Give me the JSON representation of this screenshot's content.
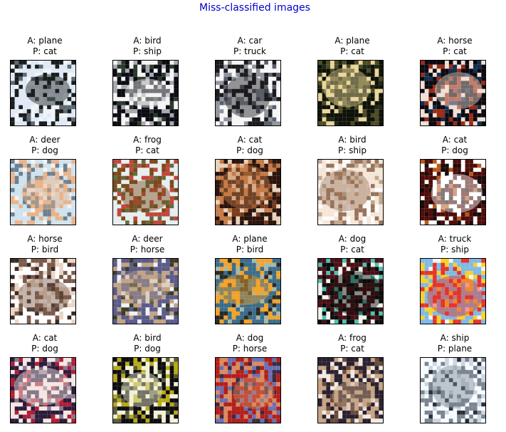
{
  "figure": {
    "title": "Miss-classified images",
    "title_color": "#0000cc"
  },
  "images": [
    {
      "actual_line": "A: plane",
      "pred_line": "P: cat",
      "icon": "misclassified-image-plane",
      "palette": [
        "#dfe9f6",
        "#1a1e1e",
        "#f0f4fa",
        "#5c6b74"
      ]
    },
    {
      "actual_line": "A: bird",
      "pred_line": "P: ship",
      "icon": "misclassified-image-bird",
      "palette": [
        "#0b0c14",
        "#f4f4f4",
        "#a7a9b0",
        "#2b3a2b"
      ]
    },
    {
      "actual_line": "A: car",
      "pred_line": "P: truck",
      "icon": "misclassified-image-car",
      "palette": [
        "#f6f6f6",
        "#1b1b1e",
        "#8f949d",
        "#5a5f70"
      ]
    },
    {
      "actual_line": "A: plane",
      "pred_line": "P: cat",
      "icon": "misclassified-image-plane",
      "palette": [
        "#0e1208",
        "#e9d699",
        "#4e4a23",
        "#1f2a14"
      ]
    },
    {
      "actual_line": "A: horse",
      "pred_line": "P: cat",
      "icon": "misclassified-image-horse",
      "palette": [
        "#0c0a10",
        "#f0dfd5",
        "#9a2b16",
        "#10304f"
      ]
    },
    {
      "actual_line": "A: deer",
      "pred_line": "P: dog",
      "icon": "misclassified-image-deer",
      "palette": [
        "#cfe3ef",
        "#e9b38a",
        "#6c7f8e",
        "#f6f2f0"
      ]
    },
    {
      "actual_line": "A: frog",
      "pred_line": "P: cat",
      "icon": "misclassified-image-frog",
      "palette": [
        "#e6eef0",
        "#7a4a1a",
        "#c2463c",
        "#5f6d40"
      ]
    },
    {
      "actual_line": "A: cat",
      "pred_line": "P: dog",
      "icon": "misclassified-image-cat",
      "palette": [
        "#2b140c",
        "#c57b46",
        "#e7d1bb",
        "#7a3c1b"
      ]
    },
    {
      "actual_line": "A: bird",
      "pred_line": "P: ship",
      "icon": "misclassified-image-bird",
      "palette": [
        "#f5e6d8",
        "#98735a",
        "#fbfbfb",
        "#c2a78f"
      ]
    },
    {
      "actual_line": "A: cat",
      "pred_line": "P: dog",
      "icon": "misclassified-image-cat",
      "palette": [
        "#4e0d0a",
        "#ffffff",
        "#1c0b0a",
        "#b65a1a"
      ]
    },
    {
      "actual_line": "A: horse",
      "pred_line": "P: bird",
      "icon": "misclassified-image-horse",
      "palette": [
        "#ffffff",
        "#7a5a4a",
        "#ead5c5",
        "#3b2b26"
      ]
    },
    {
      "actual_line": "A: deer",
      "pred_line": "P: horse",
      "icon": "misclassified-image-deer",
      "palette": [
        "#5a5b8a",
        "#c2a384",
        "#f0f2f5",
        "#3a3c27"
      ]
    },
    {
      "actual_line": "A: plane",
      "pred_line": "P: bird",
      "icon": "misclassified-image-plane",
      "palette": [
        "#3a6d8c",
        "#f2a32a",
        "#2a2a24",
        "#a9b7a5"
      ]
    },
    {
      "actual_line": "A: dog",
      "pred_line": "P: cat",
      "icon": "misclassified-image-dog",
      "palette": [
        "#4b0f17",
        "#0a0d0c",
        "#f1f3ec",
        "#4ec1b0"
      ]
    },
    {
      "actual_line": "A: truck",
      "pred_line": "P: ship",
      "icon": "misclassified-image-truck",
      "palette": [
        "#7fb9e8",
        "#e63328",
        "#f6d12b",
        "#f3f3f6"
      ]
    },
    {
      "actual_line": "A: cat",
      "pred_line": "P: dog",
      "icon": "misclassified-image-cat",
      "palette": [
        "#2c1c3c",
        "#f4e7e2",
        "#b21e36",
        "#8b7a8f"
      ]
    },
    {
      "actual_line": "A: bird",
      "pred_line": "P: dog",
      "icon": "misclassified-image-bird",
      "palette": [
        "#0d0c0e",
        "#f2f1d8",
        "#b9aa15",
        "#5a5b3a"
      ]
    },
    {
      "actual_line": "A: dog",
      "pred_line": "P: horse",
      "icon": "misclassified-image-dog",
      "palette": [
        "#b21e1b",
        "#d98b5f",
        "#6b6fb2",
        "#3d2a40"
      ]
    },
    {
      "actual_line": "A: frog",
      "pred_line": "P: cat",
      "icon": "misclassified-image-frog",
      "palette": [
        "#2a2130",
        "#c7a483",
        "#f1e9e2",
        "#6a4a3a"
      ]
    },
    {
      "actual_line": "A: ship",
      "pred_line": "P: plane",
      "icon": "misclassified-image-ship",
      "palette": [
        "#f6fbff",
        "#7a8590",
        "#cbd5e1",
        "#2c2f38"
      ]
    }
  ]
}
